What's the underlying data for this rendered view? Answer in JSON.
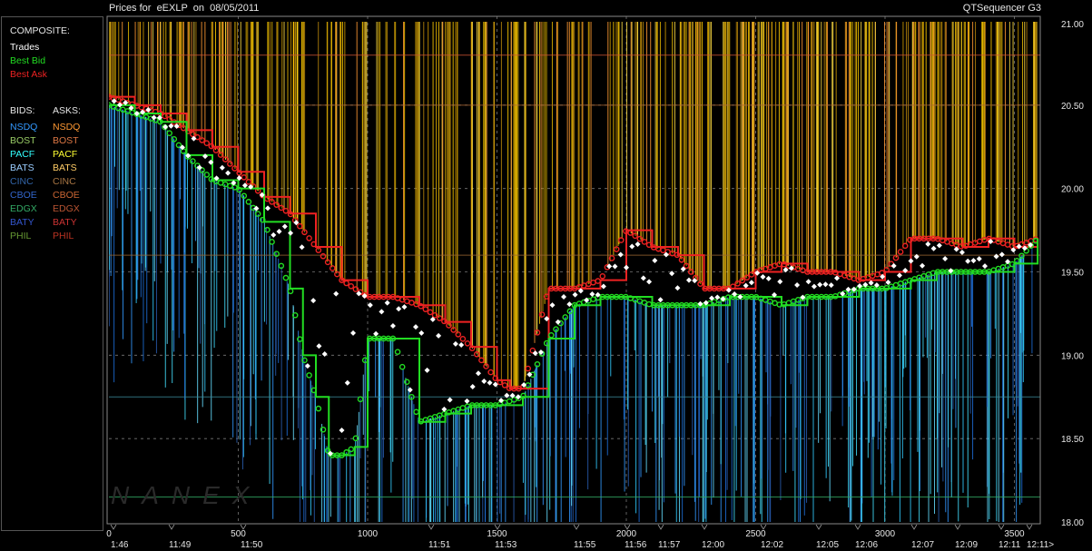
{
  "header": {
    "title": "Prices for  eEXLP  on  08/05/2011",
    "app": "QTSequencer G3"
  },
  "legend": {
    "composite_label": "COMPOSITE:",
    "composite_items": [
      {
        "label": "Trades",
        "color": "#ffffff"
      },
      {
        "label": "Best Bid",
        "color": "#22dd22"
      },
      {
        "label": "Best Ask",
        "color": "#ee2222"
      }
    ],
    "bids_label": "BIDS:",
    "asks_label": "ASKS:",
    "bids": [
      {
        "label": "NSDQ",
        "color": "#3399ff"
      },
      {
        "label": "BOST",
        "color": "#99cc66"
      },
      {
        "label": "PACF",
        "color": "#33ffff"
      },
      {
        "label": "BATS",
        "color": "#99ccff"
      },
      {
        "label": "CINC",
        "color": "#3366aa"
      },
      {
        "label": "CBOE",
        "color": "#3366cc"
      },
      {
        "label": "EDGX",
        "color": "#33aa66"
      },
      {
        "label": "BATY",
        "color": "#3355cc"
      },
      {
        "label": "PHIL",
        "color": "#669933"
      }
    ],
    "asks": [
      {
        "label": "NSDQ",
        "color": "#ff9933"
      },
      {
        "label": "BOST",
        "color": "#dd7744"
      },
      {
        "label": "PACF",
        "color": "#ffff33"
      },
      {
        "label": "BATS",
        "color": "#ffcc66"
      },
      {
        "label": "CINC",
        "color": "#aa7744"
      },
      {
        "label": "CBOE",
        "color": "#cc6633"
      },
      {
        "label": "EDGX",
        "color": "#bb5533"
      },
      {
        "label": "BATY",
        "color": "#cc3333"
      },
      {
        "label": "PHIL",
        "color": "#bb3322"
      }
    ]
  },
  "watermark": "NANEX",
  "chart_data": {
    "type": "line",
    "ylim": [
      18.0,
      21.0
    ],
    "y_ticks": [
      "21.00",
      "20.50",
      "20.00",
      "19.50",
      "19.00",
      "18.50",
      "18.00"
    ],
    "x_ticks_seq": [
      "0",
      "500",
      "1000",
      "1500",
      "2000",
      "2500",
      "3000",
      "3500"
    ],
    "x_ticks_time": [
      "1:46",
      "11:49",
      "11:50",
      "11:51",
      "11:53",
      "11:55",
      "11:56",
      "11:57",
      "12:00",
      "12:02",
      "12:05",
      "12:06",
      "12:07",
      "12:09",
      "12:11",
      "12:11>"
    ],
    "xlim": [
      0,
      3600
    ],
    "grid": true,
    "series": [
      {
        "name": "Best Ask",
        "color": "#ee2222",
        "x": [
          0,
          100,
          200,
          300,
          400,
          500,
          600,
          700,
          800,
          900,
          1000,
          1100,
          1200,
          1300,
          1400,
          1500,
          1550,
          1600,
          1700,
          1800,
          1900,
          2000,
          2100,
          2200,
          2300,
          2400,
          2500,
          2600,
          2700,
          2800,
          2900,
          3000,
          3100,
          3200,
          3300,
          3400,
          3500,
          3590
        ],
        "values": [
          20.55,
          20.5,
          20.45,
          20.35,
          20.25,
          20.1,
          19.95,
          19.85,
          19.65,
          19.45,
          19.35,
          19.35,
          19.3,
          19.2,
          19.05,
          18.85,
          18.8,
          18.8,
          19.4,
          19.4,
          19.45,
          19.75,
          19.65,
          19.6,
          19.4,
          19.4,
          19.5,
          19.55,
          19.5,
          19.5,
          19.45,
          19.5,
          19.7,
          19.7,
          19.65,
          19.7,
          19.65,
          19.7
        ]
      },
      {
        "name": "Best Bid",
        "color": "#22dd22",
        "x": [
          0,
          100,
          200,
          300,
          400,
          500,
          600,
          700,
          750,
          800,
          850,
          900,
          950,
          1000,
          1100,
          1200,
          1300,
          1400,
          1500,
          1600,
          1700,
          1800,
          1900,
          2000,
          2100,
          2200,
          2300,
          2400,
          2500,
          2600,
          2700,
          2800,
          2900,
          3000,
          3100,
          3200,
          3300,
          3400,
          3500,
          3590
        ],
        "values": [
          20.5,
          20.45,
          20.4,
          20.2,
          20.05,
          20.0,
          19.8,
          19.4,
          19.0,
          18.75,
          18.4,
          18.4,
          18.45,
          19.1,
          19.1,
          18.6,
          18.65,
          18.7,
          18.7,
          18.75,
          19.1,
          19.3,
          19.35,
          19.35,
          19.3,
          19.3,
          19.3,
          19.35,
          19.35,
          19.3,
          19.35,
          19.35,
          19.4,
          19.4,
          19.45,
          19.5,
          19.5,
          19.5,
          19.55,
          19.7
        ]
      }
    ]
  }
}
